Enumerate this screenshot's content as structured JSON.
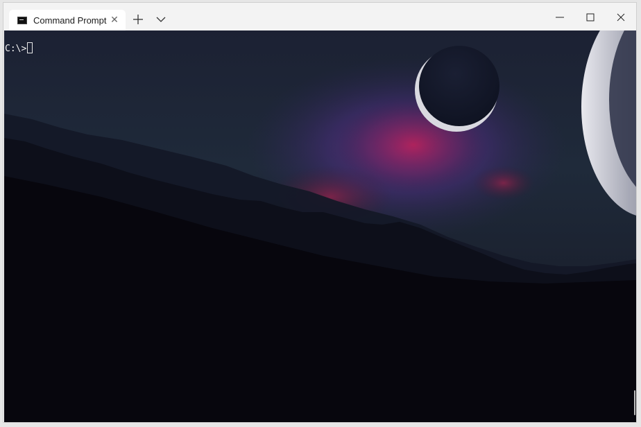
{
  "window": {
    "tab_title": "Command Prompt",
    "tab_close_glyph": "✕"
  },
  "terminal": {
    "prompt": "C:\\>"
  },
  "icons": {
    "tab_icon": "cmd-icon",
    "new_tab": "plus-icon",
    "dropdown": "chevron-down-icon",
    "minimize": "minimize-icon",
    "maximize": "maximize-icon",
    "close": "close-icon"
  },
  "colors": {
    "titlebar": "#f3f3f3",
    "terminal_background": "#07060d",
    "terminal_text": "#f0f0f0"
  }
}
